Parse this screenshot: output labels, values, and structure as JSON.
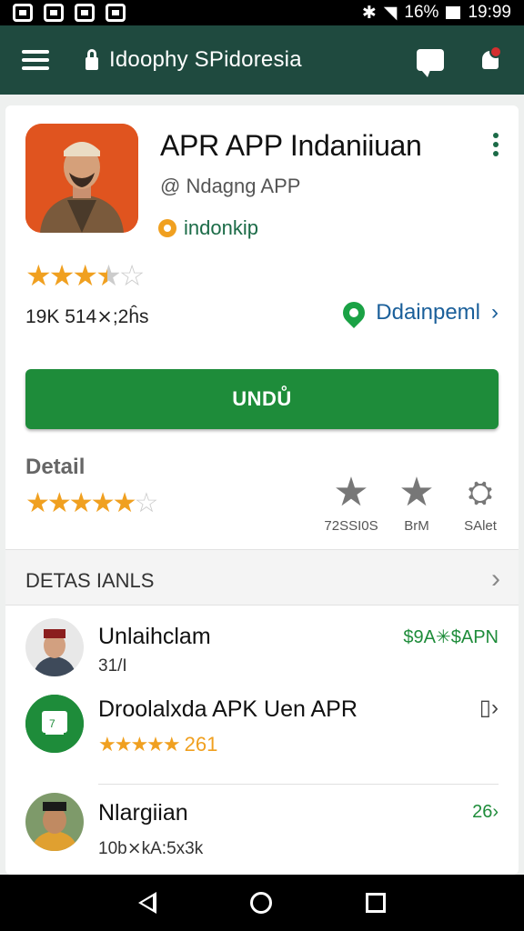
{
  "statusbar": {
    "icons_left": [
      "notification-icon",
      "notification-icon",
      "notification-icon",
      "notification-icon"
    ],
    "battery": "16%",
    "time": "19:99"
  },
  "appbar": {
    "title": "Idoophy SPidoresia",
    "icons": [
      "menu-icon",
      "lock-icon",
      "chat-icon",
      "bell-icon"
    ]
  },
  "app": {
    "title": "APR APP Indaniiuan",
    "developer": "@ Ndagng APP",
    "badge": "indonkip",
    "rating_stars": 3.5,
    "reviews": "19K 514⨯;2ĥs",
    "dev_link": "Ddainpeml",
    "dev_link_chevron": "›",
    "install_label": "UNDŮ"
  },
  "detail": {
    "label": "Detail",
    "rating_stars": 5,
    "stats": [
      {
        "icon": "star-icon",
        "label": "72SSI0S"
      },
      {
        "icon": "star-icon",
        "label": "BrM"
      },
      {
        "icon": "person-icon",
        "label": "SAlet"
      }
    ]
  },
  "section": {
    "title": "DETAS IANLS",
    "chevron": "›"
  },
  "list": [
    {
      "title": "Unlaihclam",
      "sub": "31/I",
      "right": "$9A✳$APN"
    },
    {
      "title": "Droolalxda APK Uen APR",
      "stars": "★★★★★",
      "count": "261",
      "right": "▯›"
    },
    {
      "title": "Nlargiian",
      "sub": "10b⨯kA:5x3k",
      "right": "26›"
    }
  ],
  "colors": {
    "appbar": "#1f4a3f",
    "accent_green": "#1e8c3a",
    "star": "#f0a020",
    "link_blue": "#1a5f9a",
    "icon_orange": "#e0541f"
  }
}
